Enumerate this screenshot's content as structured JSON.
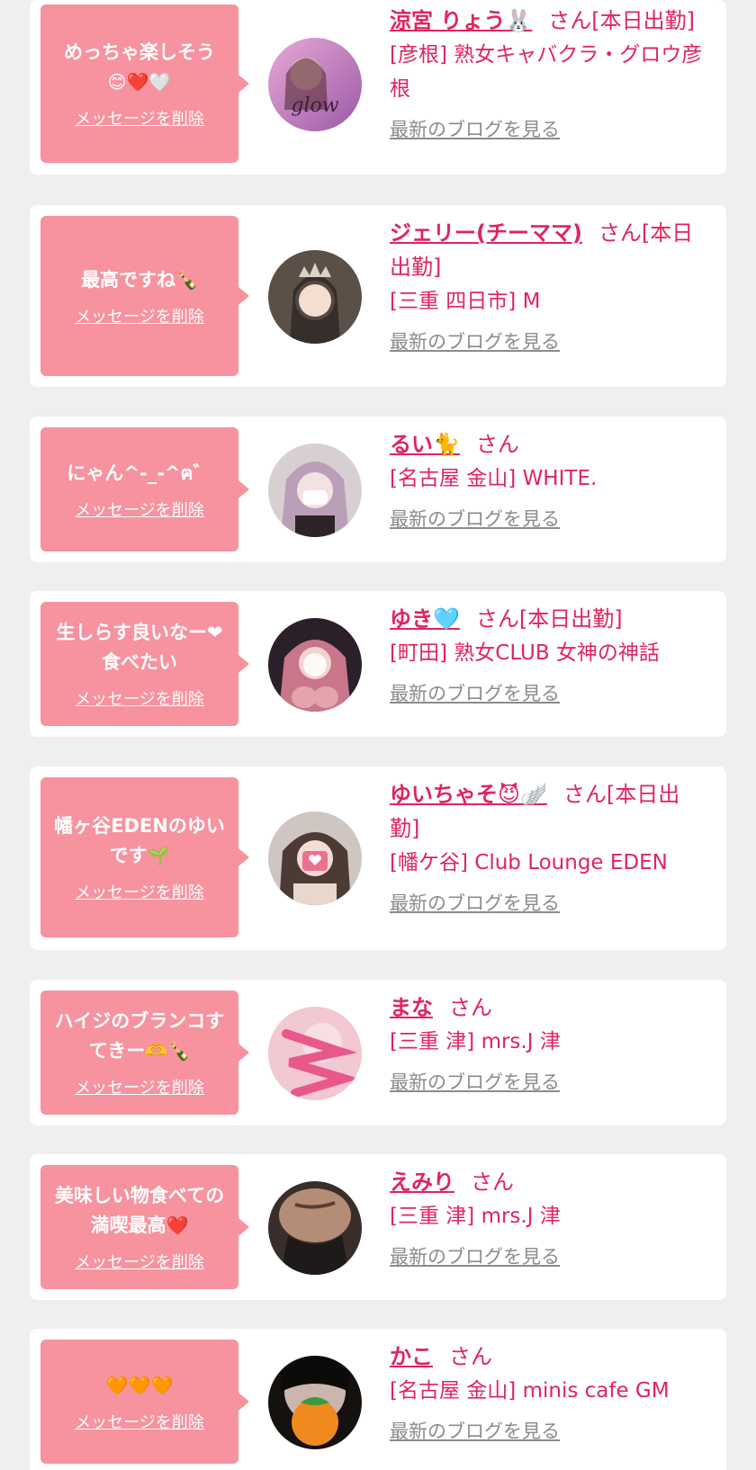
{
  "delete_label": "メッセージを削除",
  "blog_label": "最新のブログを見る",
  "san_label": "さん",
  "cards": [
    {
      "message": "めっちゃ楽しそう",
      "message_emoji": "😊❤️🤍",
      "name": "涼宮 りょう",
      "name_emoji": "🐰",
      "suffix": "さん[本日出勤]",
      "shop": "[彦根] 熟女キャバクラ・グロウ彦根"
    },
    {
      "message": "最高ですね",
      "message_emoji": "🍾",
      "name": "ジェリー(チーママ)",
      "name_emoji": "",
      "suffix": "さん[本日出勤]",
      "shop": "[三重 四日市] M"
    },
    {
      "message": "にゃん^-_-^ฅ゛",
      "message_emoji": "",
      "name": "るい",
      "name_emoji": "🐈",
      "suffix": "さん",
      "shop": "[名古屋 金山] WHITE."
    },
    {
      "message": "生しらす良いなー❤食べたい",
      "message_emoji": "",
      "name": "ゆき",
      "name_emoji": "🩵",
      "suffix": "さん[本日出勤]",
      "shop": "[町田] 熟女CLUB 女神の神話"
    },
    {
      "message": "幡ヶ谷EDENのゆいです",
      "message_emoji": "🌱",
      "name": "ゆいちゃそ",
      "name_emoji": "😈🪽",
      "suffix": "さん[本日出勤]",
      "shop": "[幡ケ谷] Club Lounge EDEN"
    },
    {
      "message": "ハイジのブランコすてきー",
      "message_emoji": "🫶🍾",
      "name": "まな",
      "name_emoji": "",
      "suffix": "さん",
      "shop": "[三重 津] mrs.J 津"
    },
    {
      "message": "美味しい物食べての満喫最高",
      "message_emoji": "❤️",
      "name": "えみり",
      "name_emoji": "",
      "suffix": "さん",
      "shop": "[三重 津] mrs.J 津"
    },
    {
      "message": "",
      "message_emoji": "🧡🧡🧡",
      "name": "かこ",
      "name_emoji": "",
      "suffix": "さん",
      "shop": "[名古屋 金山] minis cafe GM"
    }
  ]
}
